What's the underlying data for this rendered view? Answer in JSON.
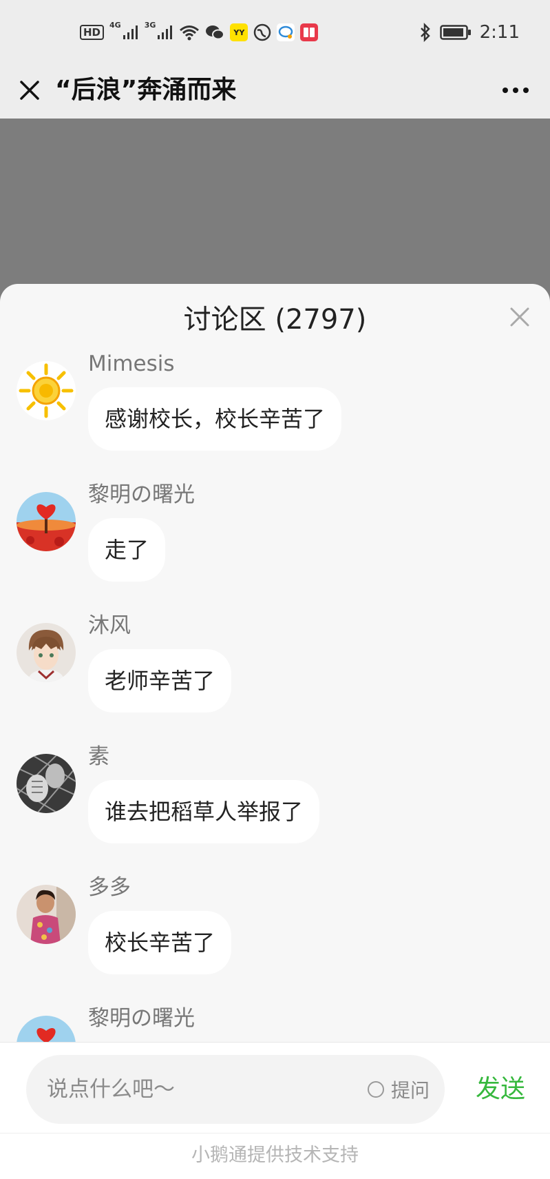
{
  "status_bar": {
    "hd": "HD",
    "net1": "4G",
    "net2": "3G",
    "app_badge_yy": "YY",
    "time": "2:11",
    "icons": [
      "hd-icon",
      "signal-4g-icon",
      "signal-3g-icon",
      "wifi-icon",
      "wechat-icon",
      "yy-app-icon",
      "browser-icon",
      "chat-app-icon",
      "reader-app-icon",
      "bluetooth-icon",
      "battery-icon"
    ]
  },
  "header": {
    "title": "“后浪”奔涌而来",
    "close_icon": "close-icon",
    "more_icon": "more-icon"
  },
  "discussion": {
    "title": "讨论区 (2797)",
    "comments": [
      {
        "name": "Mimesis",
        "text": "感谢校长，校长辛苦了",
        "avatar": "sun-avatar"
      },
      {
        "name": "黎明の曙光",
        "text": "走了",
        "avatar": "heart-tree-avatar"
      },
      {
        "name": "沐风",
        "text": "老师辛苦了",
        "avatar": "anime-boy-avatar"
      },
      {
        "name": "素",
        "text": "谁去把稻草人举报了",
        "avatar": "hands-avatar"
      },
      {
        "name": "多多",
        "text": "校长辛苦了",
        "avatar": "child-photo-avatar"
      },
      {
        "name": "黎明の曙光",
        "text": "",
        "avatar": "heart-tree-avatar"
      }
    ]
  },
  "input": {
    "placeholder": "说点什么吧～",
    "ask_label": "提问",
    "send_label": "发送"
  },
  "footer": {
    "text": "小鹅通提供技术支持"
  },
  "colors": {
    "send": "#36b83d",
    "backdrop": "#7d7d7d",
    "sheet": "#f7f7f7"
  }
}
